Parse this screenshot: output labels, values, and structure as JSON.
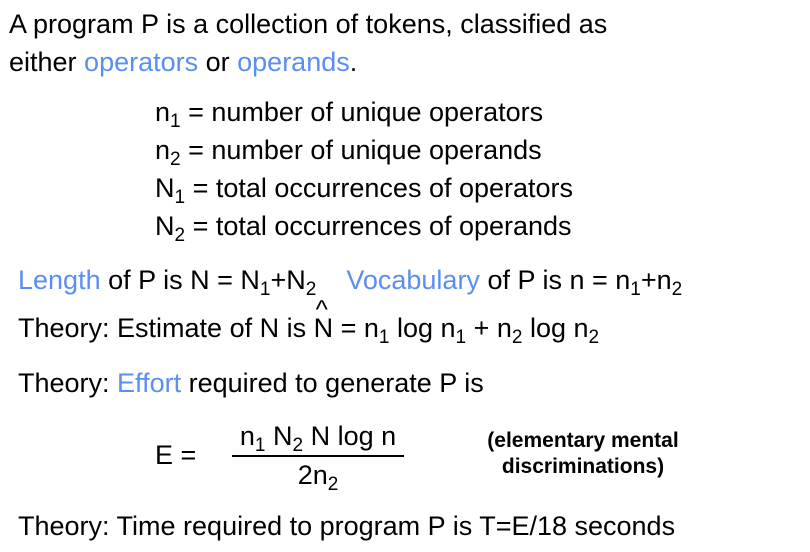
{
  "intro": {
    "line1": "A program P is a collection of tokens, classified as",
    "line2_start": "either ",
    "operators": "operators",
    "or": " or ",
    "operands": "operands",
    "period": "."
  },
  "definitions": [
    {
      "sym": "n",
      "sub": "1",
      "text": " = number of unique operators"
    },
    {
      "sym": "n",
      "sub": "2",
      "text": " = number of unique operands"
    },
    {
      "sym": "N",
      "sub": "1",
      "text": " = total occurrences of operators"
    },
    {
      "sym": "N",
      "sub": "2",
      "text": " = total occurrences of operands"
    }
  ],
  "length_line": {
    "length_word": "Length",
    "of_p": " of P is N = N",
    "sub1": "1",
    "plus": "+N",
    "sub2": "2",
    "vocab_word": "Vocabulary",
    "vocab_rest": " of P is n = n",
    "vsub1": "1",
    "vplus": "+n",
    "vsub2": "2"
  },
  "estimate_line": {
    "prefix": "Theory: Estimate of N is ",
    "n_hat": "N",
    "hat": "^",
    "eq": " = n",
    "s1": "1",
    "log1": " log n",
    "s2": "1",
    "plus": " + n",
    "s3": "2",
    "log2": " log n",
    "s4": "2"
  },
  "effort_line": {
    "prefix": "Theory: ",
    "effort_word": "Effort",
    "rest": " required to generate P is"
  },
  "formula": {
    "lhs": "E =",
    "num_n": "n",
    "num_s1": "1",
    "num_N": " N",
    "num_s2": "2",
    "num_rest": " N log n",
    "den": "2n",
    "den_sub": "2",
    "note1": "(elementary mental",
    "note2": "discriminations)"
  },
  "time_line": "Theory: Time required to program P is T=E/18 seconds"
}
